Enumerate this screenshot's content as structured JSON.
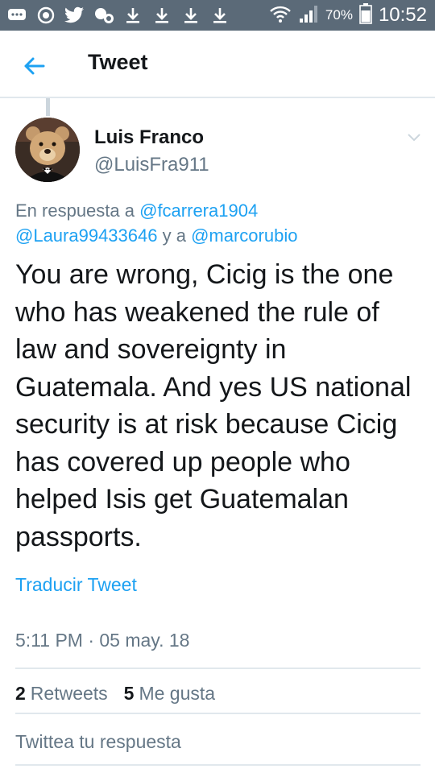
{
  "status_bar": {
    "battery_percent": "70%",
    "time": "10:52",
    "left_icons": [
      "messages-icon",
      "alarm-icon",
      "twitter-bird-icon",
      "notifications-icon",
      "download-icon",
      "download-icon",
      "download-icon",
      "download-icon"
    ],
    "right_icons": [
      "wifi-icon",
      "signal-icon",
      "battery-icon"
    ]
  },
  "header": {
    "title": "Tweet",
    "back_icon": "arrow-left-icon"
  },
  "tweet": {
    "author_name": "Luis Franco",
    "author_handle": "@LuisFra911",
    "reply_prefix": "En respuesta a ",
    "mention_1": "@fcarrera1904",
    "mention_2": "@Laura99433646",
    "reply_joiner": " y a ",
    "mention_3": "@marcorubio",
    "text": "You are wrong, Cicig is the one who has weakened the rule of law and sovereignty in Guatemala. And yes US national security is at risk because Cicig has covered up people who helped Isis get Guatemalan passports.",
    "translate_label": "Traducir Tweet",
    "timestamp": "5:11 PM · 05 may. 18",
    "retweets_count": "2",
    "retweets_label": "Retweets",
    "likes_count": "5",
    "likes_label": "Me gusta"
  },
  "reply": {
    "placeholder": "Twittea tu respuesta"
  },
  "colors": {
    "accent": "#1da1f2",
    "status_bar": "#5b6a78",
    "secondary_text": "#657786",
    "divider": "#e1e8ed"
  }
}
